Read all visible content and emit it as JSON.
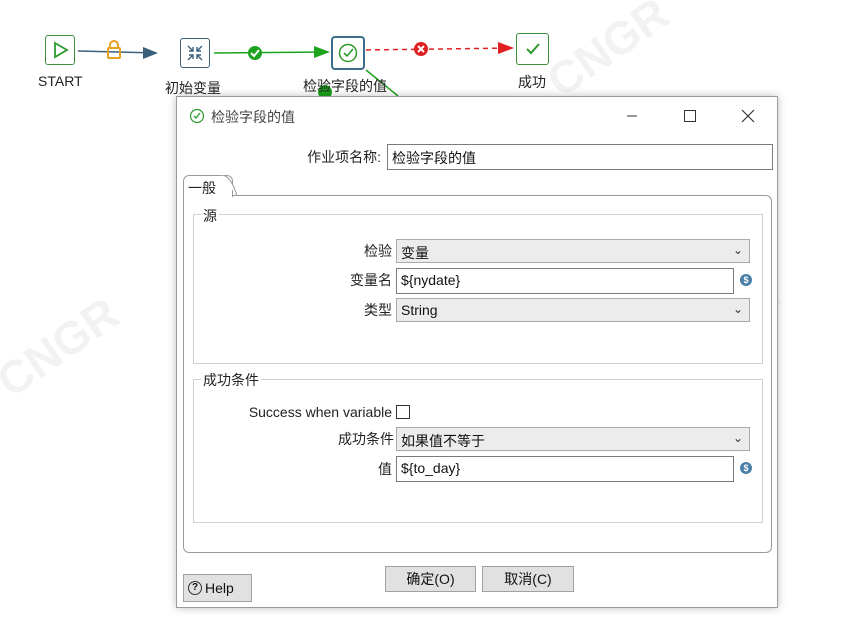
{
  "workflow": {
    "nodes": [
      {
        "id": "start",
        "label": "START"
      },
      {
        "id": "init",
        "label": "初始变量"
      },
      {
        "id": "check",
        "label": "检验字段的值"
      },
      {
        "id": "success",
        "label": "成功"
      }
    ],
    "colors": {
      "hop_ok": "#1ea31e",
      "hop_fail": "#e02020",
      "hop_plain": "#3a5f7a",
      "lock": "#e8a020"
    }
  },
  "dialog": {
    "title": "检验字段的值",
    "job_name_label": "作业项名称:",
    "job_name_value": "检验字段的值",
    "tab_general": "一般",
    "source": {
      "group_title": "源",
      "check_label": "检验",
      "check_value": "变量",
      "varname_label": "变量名",
      "varname_value": "${nydate}",
      "type_label": "类型",
      "type_value": "String"
    },
    "condition": {
      "group_title": "成功条件",
      "success_when_variable_label": "Success when variable",
      "success_when_variable_checked": false,
      "cond_label": "成功条件",
      "cond_value": "如果值不等于",
      "value_label": "值",
      "value_value": "${to_day}"
    },
    "buttons": {
      "help": "Help",
      "ok": "确定(O)",
      "cancel": "取消(C)"
    }
  }
}
